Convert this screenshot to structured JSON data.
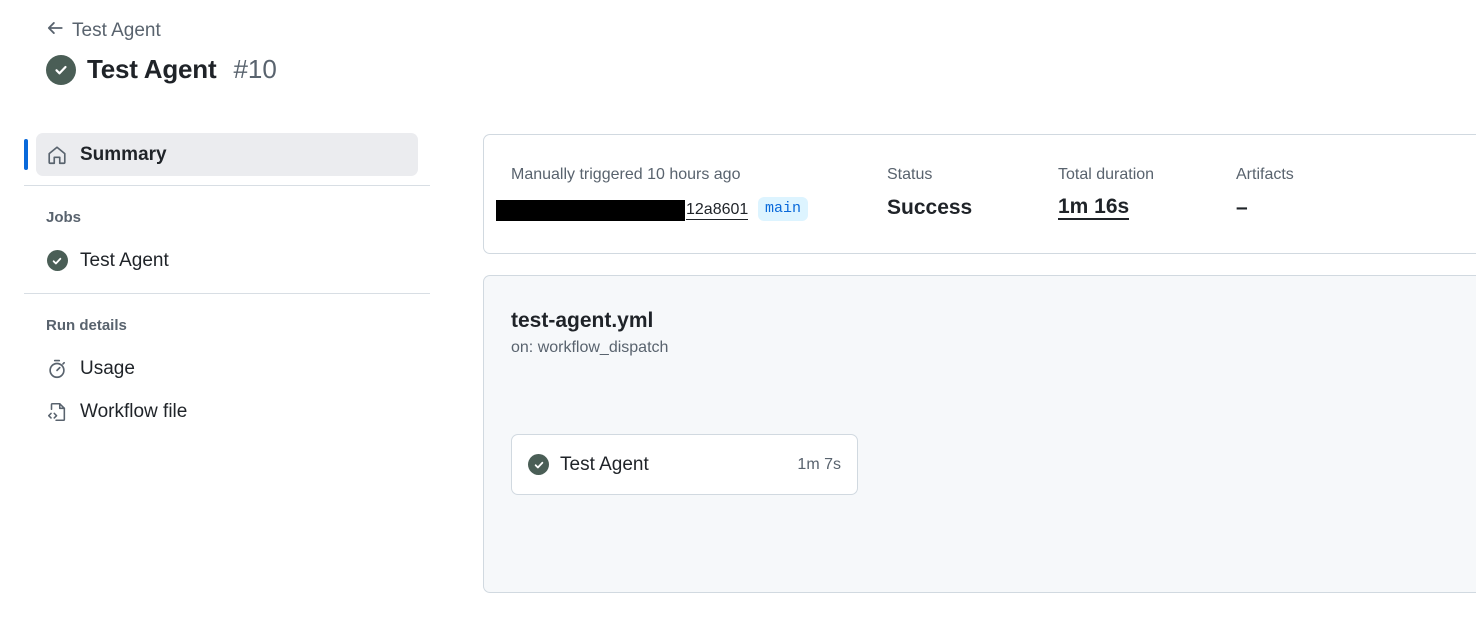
{
  "header": {
    "back_label": "Test Agent",
    "title": "Test Agent",
    "run_number": "#10"
  },
  "sidebar": {
    "summary_label": "Summary",
    "jobs_heading": "Jobs",
    "jobs": [
      {
        "label": "Test Agent",
        "status": "success"
      }
    ],
    "run_details_heading": "Run details",
    "run_details": [
      {
        "label": "Usage",
        "icon": "stopwatch-icon"
      },
      {
        "label": "Workflow file",
        "icon": "file-code-icon"
      }
    ]
  },
  "summary": {
    "trigger_text": "Manually triggered 10 hours ago",
    "commit_sha": "12a8601",
    "branch": "main",
    "status_label": "Status",
    "status_value": "Success",
    "duration_label": "Total duration",
    "duration_value": "1m 16s",
    "artifacts_label": "Artifacts",
    "artifacts_value": "–"
  },
  "workflow": {
    "file_name": "test-agent.yml",
    "trigger": "on: workflow_dispatch",
    "jobs": [
      {
        "name": "Test Agent",
        "duration": "1m 7s",
        "status": "success"
      }
    ]
  },
  "colors": {
    "success_icon": "#4a5e56",
    "accent": "#0969da",
    "branch_bg": "#ddf4ff"
  }
}
